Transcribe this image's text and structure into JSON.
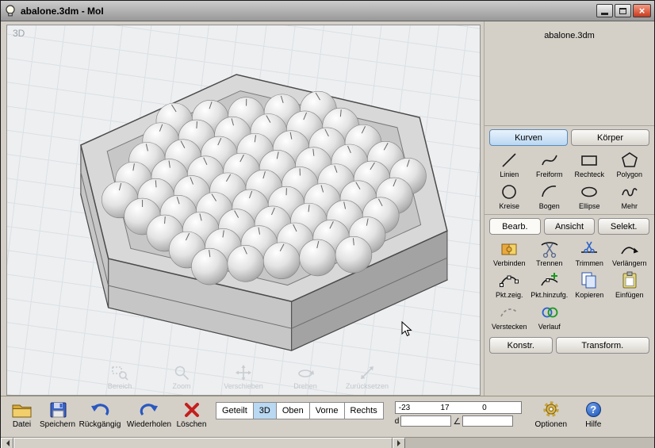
{
  "titlebar": {
    "title": "abalone.3dm - MoI",
    "close_glyph": "×"
  },
  "viewport": {
    "label": "3D",
    "nav": [
      {
        "label": "Bereich",
        "icon": "zoom-area-icon"
      },
      {
        "label": "Zoom",
        "icon": "zoom-icon"
      },
      {
        "label": "Verschieben",
        "icon": "pan-icon"
      },
      {
        "label": "Drehen",
        "icon": "rotate-icon"
      },
      {
        "label": "Zurücksetzen",
        "icon": "reset-view-icon"
      }
    ]
  },
  "sidebar": {
    "filename": "abalone.3dm",
    "top_tabs": [
      {
        "label": "Kurven",
        "active": true
      },
      {
        "label": "Körper",
        "active": false
      }
    ],
    "curve_tools": [
      {
        "label": "Linien",
        "icon": "line-icon"
      },
      {
        "label": "Freiform",
        "icon": "freeform-icon"
      },
      {
        "label": "Rechteck",
        "icon": "rectangle-icon"
      },
      {
        "label": "Polygon",
        "icon": "polygon-icon"
      },
      {
        "label": "Kreise",
        "icon": "circle-icon"
      },
      {
        "label": "Bogen",
        "icon": "arc-icon"
      },
      {
        "label": "Ellipse",
        "icon": "ellipse-icon"
      },
      {
        "label": "Mehr",
        "icon": "more-curves-icon"
      }
    ],
    "mid_tabs": [
      {
        "label": "Bearb.",
        "active": true
      },
      {
        "label": "Ansicht",
        "active": false
      },
      {
        "label": "Selekt.",
        "active": false
      }
    ],
    "edit_tools": [
      {
        "label": "Verbinden",
        "icon": "join-icon"
      },
      {
        "label": "Trennen",
        "icon": "separate-icon"
      },
      {
        "label": "Trimmen",
        "icon": "trim-icon"
      },
      {
        "label": "Verlängern",
        "icon": "extend-icon"
      },
      {
        "label": "Pkt.zeig.",
        "icon": "show-points-icon"
      },
      {
        "label": "Pkt.hinzufg.",
        "icon": "add-point-icon"
      },
      {
        "label": "Kopieren",
        "icon": "copy-icon"
      },
      {
        "label": "Einfügen",
        "icon": "paste-icon"
      },
      {
        "label": "Verstecken",
        "icon": "hide-icon"
      },
      {
        "label": "Verlauf",
        "icon": "blend-icon"
      }
    ],
    "footer_buttons": [
      {
        "label": "Konstr."
      },
      {
        "label": "Transform."
      }
    ]
  },
  "toolbar": {
    "file_tools": [
      {
        "label": "Datei",
        "icon": "folder-icon"
      },
      {
        "label": "Speichern",
        "icon": "save-icon"
      },
      {
        "label": "Rückgängig",
        "icon": "undo-icon"
      },
      {
        "label": "Wiederholen",
        "icon": "redo-icon"
      },
      {
        "label": "Löschen",
        "icon": "delete-icon"
      }
    ],
    "view_tabs": [
      {
        "label": "Geteilt",
        "active": false
      },
      {
        "label": "3D",
        "active": true
      },
      {
        "label": "Oben",
        "active": false
      },
      {
        "label": "Vorne",
        "active": false
      },
      {
        "label": "Rechts",
        "active": false
      }
    ],
    "coords": {
      "x": "-23",
      "y": "17",
      "z": "0",
      "d_label": "d",
      "d_value": "",
      "angle_label": "∠",
      "angle_value": ""
    },
    "options_label": "Optionen",
    "help_label": "Hilfe",
    "help_glyph": "?"
  },
  "colors": {
    "accent_blue": "#b9d8f2",
    "close_red": "#c63a1d",
    "viewport_bg": "#edeff1"
  }
}
